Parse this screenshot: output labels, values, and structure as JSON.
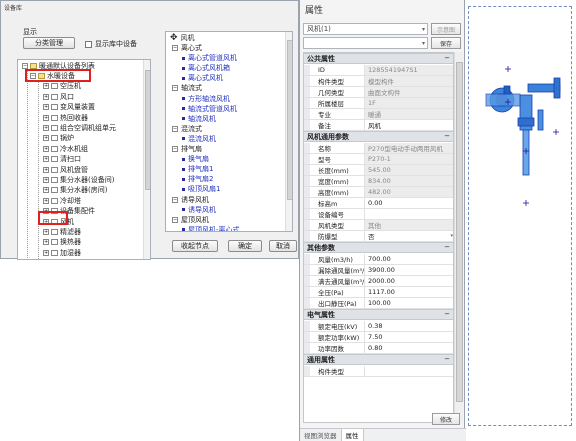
{
  "dialog": {
    "title": "设备库",
    "display_label": "显示",
    "manage_button": "分类管理",
    "show_library_label": "显示库中设备",
    "tree_root": "暖通默认设备列表",
    "tree_items": [
      "水暖设备",
      "空压机",
      "风口",
      "变风量装置",
      "热回收器",
      "组合空调机组单元",
      "锅炉",
      "冷水机组",
      "清扫口",
      "风机盘管",
      "集分水器(设备间)",
      "集分水器(房间)",
      "冷却塔",
      "设备集配件",
      "风机",
      "精滤器",
      "换热器",
      "加湿器",
      "储水器"
    ],
    "right_tree": {
      "root": "风机",
      "groups": [
        {
          "label": "离心式",
          "children": [
            "离心式管道风机",
            "离心式风机箱",
            "离心式风机"
          ]
        },
        {
          "label": "轴流式",
          "children": [
            "方形轴流风机",
            "轴流式管道风机",
            "轴流风机"
          ]
        },
        {
          "label": "混流式",
          "children": [
            "混流风机"
          ]
        },
        {
          "label": "排气扇",
          "children": [
            "换气扇",
            "排气扇1",
            "排气扇2",
            "吸顶风扇1"
          ]
        },
        {
          "label": "诱导风机",
          "children": [
            "诱导风机"
          ]
        },
        {
          "label": "屋顶风机",
          "children": [
            "屋顶风机-离心式",
            "屋顶风机-轴流式"
          ]
        },
        {
          "label": "其他",
          "children": [
            "P270型电动手动两用风机"
          ]
        }
      ]
    },
    "collapse_button": "收起节点",
    "ok_button": "确定",
    "cancel_button": "取消"
  },
  "properties": {
    "title": "属性",
    "type_selector": "风机(1)",
    "show_button": "示意图",
    "save_button": "保存",
    "sections": [
      {
        "title": "公共属性",
        "rows": [
          {
            "key": "ID",
            "value": "1285541947S1",
            "readonly": true
          },
          {
            "key": "构件类型",
            "value": "模型构件",
            "readonly": true
          },
          {
            "key": "几何类型",
            "value": "曲面文构件",
            "readonly": true
          },
          {
            "key": "所属楼层",
            "value": "1F",
            "readonly": true
          },
          {
            "key": "专业",
            "value": "暖通",
            "readonly": true
          },
          {
            "key": "备注",
            "value": "风机",
            "readonly": false
          }
        ]
      },
      {
        "title": "风机通用参数",
        "rows": [
          {
            "key": "名称",
            "value": "P270型电动手动两用风机",
            "readonly": true
          },
          {
            "key": "型号",
            "value": "P270-1",
            "readonly": true
          },
          {
            "key": "长度(mm)",
            "value": "545.00",
            "readonly": true
          },
          {
            "key": "宽度(mm)",
            "value": "834.00",
            "readonly": true
          },
          {
            "key": "高度(mm)",
            "value": "482.00",
            "readonly": true
          },
          {
            "key": "标高m",
            "value": "0.00",
            "readonly": false
          },
          {
            "key": "设备编号",
            "value": "",
            "readonly": false
          },
          {
            "key": "风机类型",
            "value": "其他",
            "readonly": true
          },
          {
            "key": "防爆型",
            "value": "否",
            "readonly": false,
            "select": true
          }
        ]
      },
      {
        "title": "其他参数",
        "rows": [
          {
            "key": "风量(m3/h)",
            "value": "700.00",
            "readonly": false
          },
          {
            "key": "漏除通风量(m³/h)",
            "value": "3900.00",
            "readonly": false
          },
          {
            "key": "满去通风量(m³/h)",
            "value": "2000.00",
            "readonly": false
          },
          {
            "key": "全压(Pa)",
            "value": "1117.00",
            "readonly": false
          },
          {
            "key": "出口静压(Pa)",
            "value": "100.00",
            "readonly": false
          }
        ]
      },
      {
        "title": "电气属性",
        "rows": [
          {
            "key": "额定电压(kV)",
            "value": "0.38",
            "readonly": false
          },
          {
            "key": "额定功率(kW)",
            "value": "7.50",
            "readonly": false
          },
          {
            "key": "功率因数",
            "value": "0.80",
            "readonly": false
          }
        ]
      },
      {
        "title": "通用属性",
        "rows": [
          {
            "key": "构件类型",
            "value": "",
            "readonly": false
          }
        ]
      }
    ],
    "modify_button": "修改",
    "tabs": [
      "视图浏览器",
      "属性"
    ]
  }
}
